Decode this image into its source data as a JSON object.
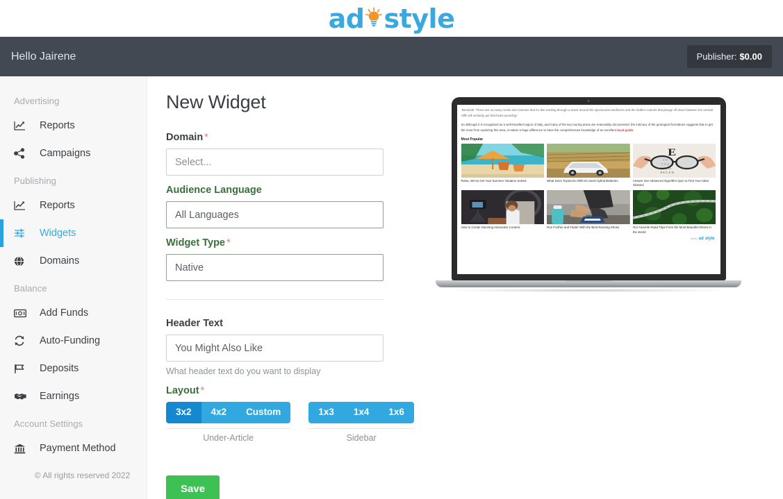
{
  "brand": {
    "logo_ad": "ad",
    "logo_style": "style",
    "logo_mark_icon": "lightbulb-icon",
    "accent_blue": "#3aa9e0",
    "accent_orange": "#f0962c",
    "accent_green": "#3cc152",
    "topbar_bg": "#434952"
  },
  "topbar": {
    "greeting": "Hello Jairene",
    "publisher_label": "Publisher:",
    "publisher_amount": "$0.00"
  },
  "sidebar": {
    "groups": [
      {
        "title": "Advertising",
        "items": [
          {
            "label": "Reports",
            "icon": "chart-line-icon",
            "active": false
          },
          {
            "label": "Campaigns",
            "icon": "share-nodes-icon",
            "active": false
          }
        ]
      },
      {
        "title": "Publishing",
        "items": [
          {
            "label": "Reports",
            "icon": "chart-line-icon",
            "active": false
          },
          {
            "label": "Widgets",
            "icon": "sliders-icon",
            "active": true
          },
          {
            "label": "Domains",
            "icon": "globe-icon",
            "active": false
          }
        ]
      },
      {
        "title": "Balance",
        "items": [
          {
            "label": "Add Funds",
            "icon": "money-bill-icon",
            "active": false
          },
          {
            "label": "Auto-Funding",
            "icon": "sync-arrows-icon",
            "active": false
          },
          {
            "label": "Deposits",
            "icon": "flag-icon",
            "active": false
          },
          {
            "label": "Earnings",
            "icon": "handshake-icon",
            "active": false
          }
        ]
      },
      {
        "title": "Account Settings",
        "items": [
          {
            "label": "Payment Method",
            "icon": "bank-icon",
            "active": false
          }
        ]
      }
    ],
    "copyright": "© All rights reserved 2022"
  },
  "form": {
    "title": "New Widget",
    "domain": {
      "label": "Domain",
      "required_mark": "*",
      "value": "Select..."
    },
    "audience_language": {
      "label": "Audience Language",
      "value": "All Languages"
    },
    "widget_type": {
      "label": "Widget Type",
      "required_mark": "*",
      "value": "Native"
    },
    "header_text": {
      "label": "Header Text",
      "value": "You Might Also Like",
      "helper": "What header text do you want to display"
    },
    "layout": {
      "label": "Layout",
      "required_mark": "*",
      "groups": [
        {
          "caption": "Under-Article",
          "options": [
            {
              "label": "3x2",
              "selected": true
            },
            {
              "label": "4x2",
              "selected": false
            },
            {
              "label": "Custom",
              "selected": false
            }
          ]
        },
        {
          "caption": "Sidebar",
          "options": [
            {
              "label": "1x3",
              "selected": false
            },
            {
              "label": "1x4",
              "selected": false
            },
            {
              "label": "1x6",
              "selected": false
            }
          ]
        }
      ]
    },
    "save_label": "Save"
  },
  "preview": {
    "device": "laptop-mockup",
    "article_paragraph_clipped": " Bertolotti. 'There are so many nooks and crannies that it's like working through a maze around the spectacular landforms and the hidden couloirs that plunge off down between the vertical cliffs will certainly get that heart pounding.'",
    "article_paragraph_2_a": "So although it is recognised as a well-travelled region of Italy, and many of the key touring areas are reasonably documented, the intricacy of the geological formations suggests that to get the most from exploring this area, it makes a huge difference to have the comprehensive knowledge of an excellent ",
    "article_paragraph_2_link": "local guide",
    "article_paragraph_2_b": ".",
    "widget_heading": "Most Popular",
    "cards": [
      {
        "title": "Relax, We've Got Your Summer Vacation Sorted",
        "image": "beach-umbrella-chair-photo"
      },
      {
        "title": "What Does Toyota Do With Its Used Hybrid Batteries",
        "image": "white-suv-vineyard-photo"
      },
      {
        "title": "Answer Our Advanced Algorithm Quiz to Find Your Ideal Glasses",
        "image": "eyeglasses-eye-chart-photo"
      },
      {
        "title": "How to Create Stunning Interactive Content",
        "image": "woman-video-studio-photo"
      },
      {
        "title": "Run Further and Faster With the Best Running Shoes",
        "image": "runner-tying-shoes-photo"
      },
      {
        "title": "Our Favorite Road Trips From the Most Beautiful Drives in the World",
        "image": "aerial-forest-road-photo"
      }
    ],
    "footer_ads_by": "Ads by",
    "footer_brand_ad": "ad",
    "footer_brand_style": "style"
  }
}
